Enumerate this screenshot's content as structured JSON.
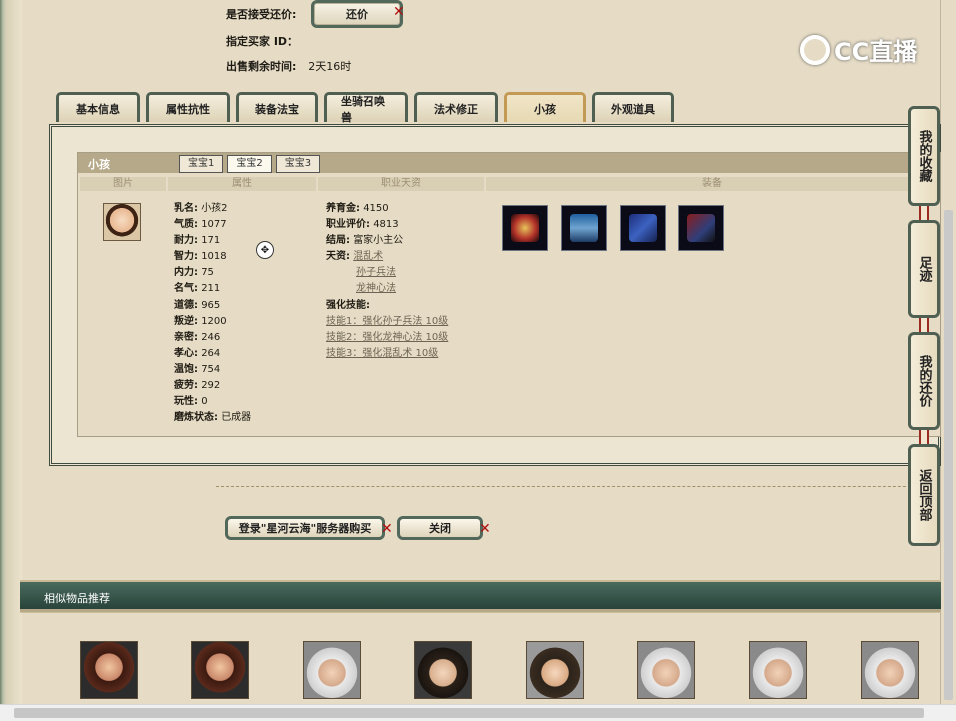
{
  "trade_info": {
    "accept_counter_label": "是否接受还价:",
    "counter_button_label": "还价",
    "buyer_id_label": "指定买家 ID：",
    "remaining_label": "出售剩余时间:",
    "remaining_value": "2天16时"
  },
  "watermark": "CC直播",
  "tabs": [
    "基本信息",
    "属性抗性",
    "装备法宝",
    "坐骑召唤兽",
    "法术修正",
    "小孩",
    "外观道具"
  ],
  "active_tab": "小孩",
  "child_panel": {
    "title": "小孩",
    "sub_tabs": [
      "宝宝1",
      "宝宝2",
      "宝宝3"
    ],
    "active_sub_tab": "宝宝2",
    "columns": [
      "图片",
      "属性",
      "职业天资",
      "装备"
    ],
    "attributes": [
      {
        "k": "乳名:",
        "v": "小孩2"
      },
      {
        "k": "气质:",
        "v": "1077"
      },
      {
        "k": "耐力:",
        "v": "171"
      },
      {
        "k": "智力:",
        "v": "1018"
      },
      {
        "k": "内力:",
        "v": "75"
      },
      {
        "k": "名气:",
        "v": "211"
      },
      {
        "k": "道德:",
        "v": "965"
      },
      {
        "k": "叛逆:",
        "v": "1200"
      },
      {
        "k": "亲密:",
        "v": "246"
      },
      {
        "k": "孝心:",
        "v": "264"
      },
      {
        "k": "温饱:",
        "v": "754"
      },
      {
        "k": "疲劳:",
        "v": "292"
      },
      {
        "k": "玩性:",
        "v": "0"
      },
      {
        "k": "磨炼状态:",
        "v": "已成器"
      }
    ],
    "career": {
      "raise_money_label": "养育金:",
      "raise_money": "4150",
      "career_score_label": "职业评价:",
      "career_score": "4813",
      "ending_label": "结局:",
      "ending": "富家小主公",
      "talent_label": "天资:",
      "talents": [
        "混乱术",
        "孙子兵法",
        "龙神心法"
      ],
      "skills_label": "强化技能:",
      "skills": [
        "技能1：强化孙子兵法 10级",
        "技能2：强化龙神心法 10级",
        "技能3：强化混乱术 10级"
      ]
    },
    "equipment_icons": [
      "helmet-icon",
      "robe-icon",
      "book-icon",
      "chest-icon"
    ]
  },
  "buttons": {
    "buy_label": "登录\"星河云海\"服务器购买",
    "close_label": "关闭"
  },
  "side_tabs": [
    "我的收藏",
    "足迹",
    "我的还价",
    "返回顶部"
  ],
  "similar": {
    "title": "相似物品推荐",
    "portraits": [
      "female-warrior",
      "female-warrior",
      "white-hair-elder",
      "young-swordsman",
      "young-man",
      "white-hair-elder",
      "white-hair-elder",
      "white-hair-elder"
    ]
  },
  "colors": {
    "accent": "#52685a",
    "bar": "#29443a",
    "close_x": "#b01010"
  }
}
